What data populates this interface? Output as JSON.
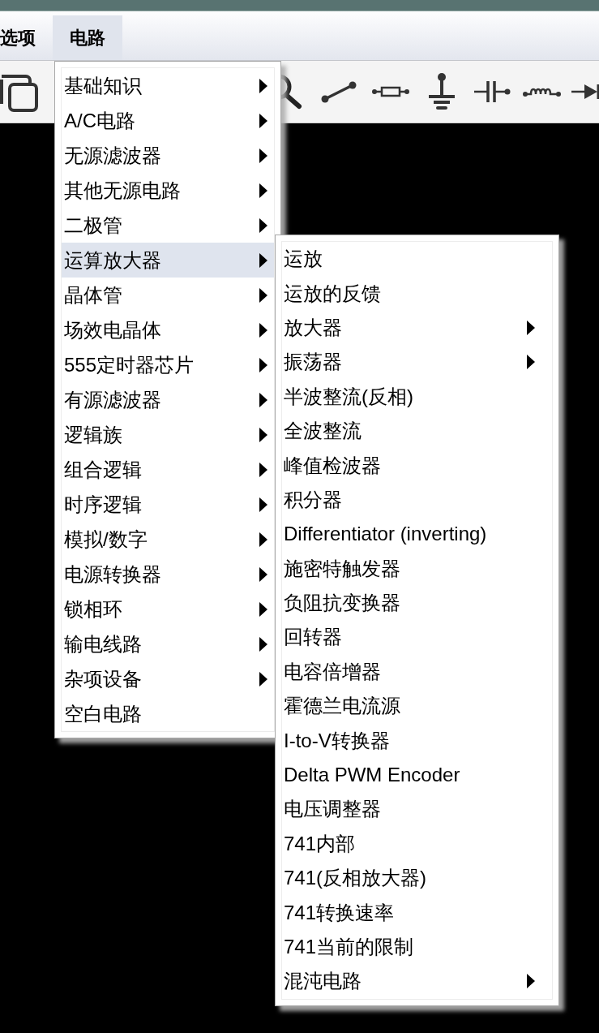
{
  "menu_bar": [
    {
      "label": "选项",
      "selected": false
    },
    {
      "label": "电路",
      "selected": true
    }
  ],
  "dropdown_menu": {
    "items": [
      {
        "label": "基础知识",
        "has_submenu": true,
        "selected": false
      },
      {
        "label": "A/C电路",
        "has_submenu": true,
        "selected": false
      },
      {
        "label": "无源滤波器",
        "has_submenu": true,
        "selected": false
      },
      {
        "label": "其他无源电路",
        "has_submenu": true,
        "selected": false
      },
      {
        "label": "二极管",
        "has_submenu": true,
        "selected": false
      },
      {
        "label": "运算放大器",
        "has_submenu": true,
        "selected": true
      },
      {
        "label": "晶体管",
        "has_submenu": true,
        "selected": false
      },
      {
        "label": "场效电晶体",
        "has_submenu": true,
        "selected": false
      },
      {
        "label": "555定时器芯片",
        "has_submenu": true,
        "selected": false
      },
      {
        "label": "有源滤波器",
        "has_submenu": true,
        "selected": false
      },
      {
        "label": "逻辑族",
        "has_submenu": true,
        "selected": false
      },
      {
        "label": "组合逻辑",
        "has_submenu": true,
        "selected": false
      },
      {
        "label": "时序逻辑",
        "has_submenu": true,
        "selected": false
      },
      {
        "label": "模拟/数字",
        "has_submenu": true,
        "selected": false
      },
      {
        "label": "电源转换器",
        "has_submenu": true,
        "selected": false
      },
      {
        "label": "锁相环",
        "has_submenu": true,
        "selected": false
      },
      {
        "label": "输电线路",
        "has_submenu": true,
        "selected": false
      },
      {
        "label": "杂项设备",
        "has_submenu": true,
        "selected": false
      },
      {
        "label": "空白电路",
        "has_submenu": false,
        "selected": false
      }
    ]
  },
  "submenu": {
    "items": [
      {
        "label": "运放",
        "has_submenu": false,
        "selected": false
      },
      {
        "label": "运放的反馈",
        "has_submenu": false,
        "selected": false
      },
      {
        "label": "放大器",
        "has_submenu": true,
        "selected": false
      },
      {
        "label": "振荡器",
        "has_submenu": true,
        "selected": false
      },
      {
        "label": "半波整流(反相)",
        "has_submenu": false,
        "selected": false
      },
      {
        "label": "全波整流",
        "has_submenu": false,
        "selected": false
      },
      {
        "label": "峰值检波器",
        "has_submenu": false,
        "selected": false
      },
      {
        "label": "积分器",
        "has_submenu": false,
        "selected": false
      },
      {
        "label": "Differentiator (inverting)",
        "has_submenu": false,
        "selected": false
      },
      {
        "label": "施密特触发器",
        "has_submenu": false,
        "selected": false
      },
      {
        "label": "负阻抗变换器",
        "has_submenu": false,
        "selected": false
      },
      {
        "label": "回转器",
        "has_submenu": false,
        "selected": false
      },
      {
        "label": "电容倍增器",
        "has_submenu": false,
        "selected": false
      },
      {
        "label": "霍德兰电流源",
        "has_submenu": false,
        "selected": false
      },
      {
        "label": "I-to-V转换器",
        "has_submenu": false,
        "selected": false
      },
      {
        "label": "Delta PWM Encoder",
        "has_submenu": false,
        "selected": false
      },
      {
        "label": "电压调整器",
        "has_submenu": false,
        "selected": false
      },
      {
        "label": "741内部",
        "has_submenu": false,
        "selected": false
      },
      {
        "label": "741(反相放大器)",
        "has_submenu": false,
        "selected": false
      },
      {
        "label": "741转换速率",
        "has_submenu": false,
        "selected": false
      },
      {
        "label": "741当前的限制",
        "has_submenu": false,
        "selected": false
      },
      {
        "label": "混沌电路",
        "has_submenu": true,
        "selected": false
      }
    ]
  }
}
